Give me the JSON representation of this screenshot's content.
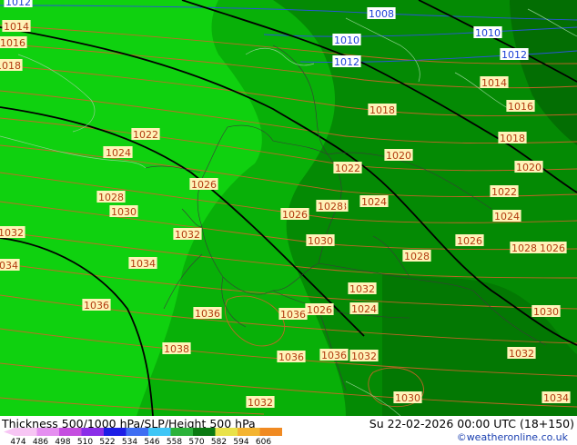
{
  "footer": {
    "title": "Thickness 500/1000 hPa/SLP/Height 500 hPa",
    "datetime": "Su 22-02-2026 00:00 UTC (18+150)",
    "credit": "©weatheronline.co.uk"
  },
  "legend": {
    "ticks": [
      "474",
      "486",
      "498",
      "510",
      "522",
      "534",
      "546",
      "558",
      "570",
      "582",
      "594",
      "606"
    ],
    "colors": [
      "#f7c6f4",
      "#e58ff0",
      "#c54ee0",
      "#8a2ee8",
      "#1d1ee6",
      "#3f6ef2",
      "#3ec6f6",
      "#2bb23a",
      "#0b7a12",
      "#e9e24a",
      "#f4b431",
      "#f08a22"
    ]
  },
  "map": {
    "field_colors": {
      "light": "#0fd10f",
      "mid": "#08b008",
      "dark": "#048a04",
      "darkest": "#036e03"
    },
    "isobar_labels": [
      {
        "text": "1012"
      },
      {
        "text": "1008"
      },
      {
        "text": "1010"
      },
      {
        "text": "1010"
      },
      {
        "text": "1012"
      },
      {
        "text": "1012"
      },
      {
        "text": "1014"
      },
      {
        "text": "1016"
      },
      {
        "text": "1018"
      },
      {
        "text": "1014"
      },
      {
        "text": "1016"
      },
      {
        "text": "1018"
      },
      {
        "text": "1022"
      },
      {
        "text": "1024"
      },
      {
        "text": "1026"
      },
      {
        "text": "1028"
      },
      {
        "text": "1030"
      },
      {
        "text": "1032"
      },
      {
        "text": "1034"
      },
      {
        "text": "1036"
      },
      {
        "text": "1036"
      },
      {
        "text": "1038"
      },
      {
        "text": "1036"
      },
      {
        "text": "1032"
      },
      {
        "text": "1034"
      },
      {
        "text": "1036"
      },
      {
        "text": "1032"
      },
      {
        "text": "1030"
      },
      {
        "text": "1028"
      },
      {
        "text": "1026"
      },
      {
        "text": "1022"
      },
      {
        "text": "1024"
      },
      {
        "text": "1020"
      },
      {
        "text": "1020"
      },
      {
        "text": "1018"
      },
      {
        "text": "1022"
      },
      {
        "text": "1024"
      },
      {
        "text": "1026"
      },
      {
        "text": "1026"
      },
      {
        "text": "1028"
      },
      {
        "text": "1030"
      },
      {
        "text": "1032"
      },
      {
        "text": "1034"
      },
      {
        "text": "1032"
      },
      {
        "text": "1030"
      },
      {
        "text": "1028"
      },
      {
        "text": "1024"
      },
      {
        "text": "1026"
      },
      {
        "text": "1030"
      },
      {
        "text": "1032"
      },
      {
        "text": "1036"
      },
      {
        "text": "1024"
      },
      {
        "text": "1028"
      }
    ]
  }
}
